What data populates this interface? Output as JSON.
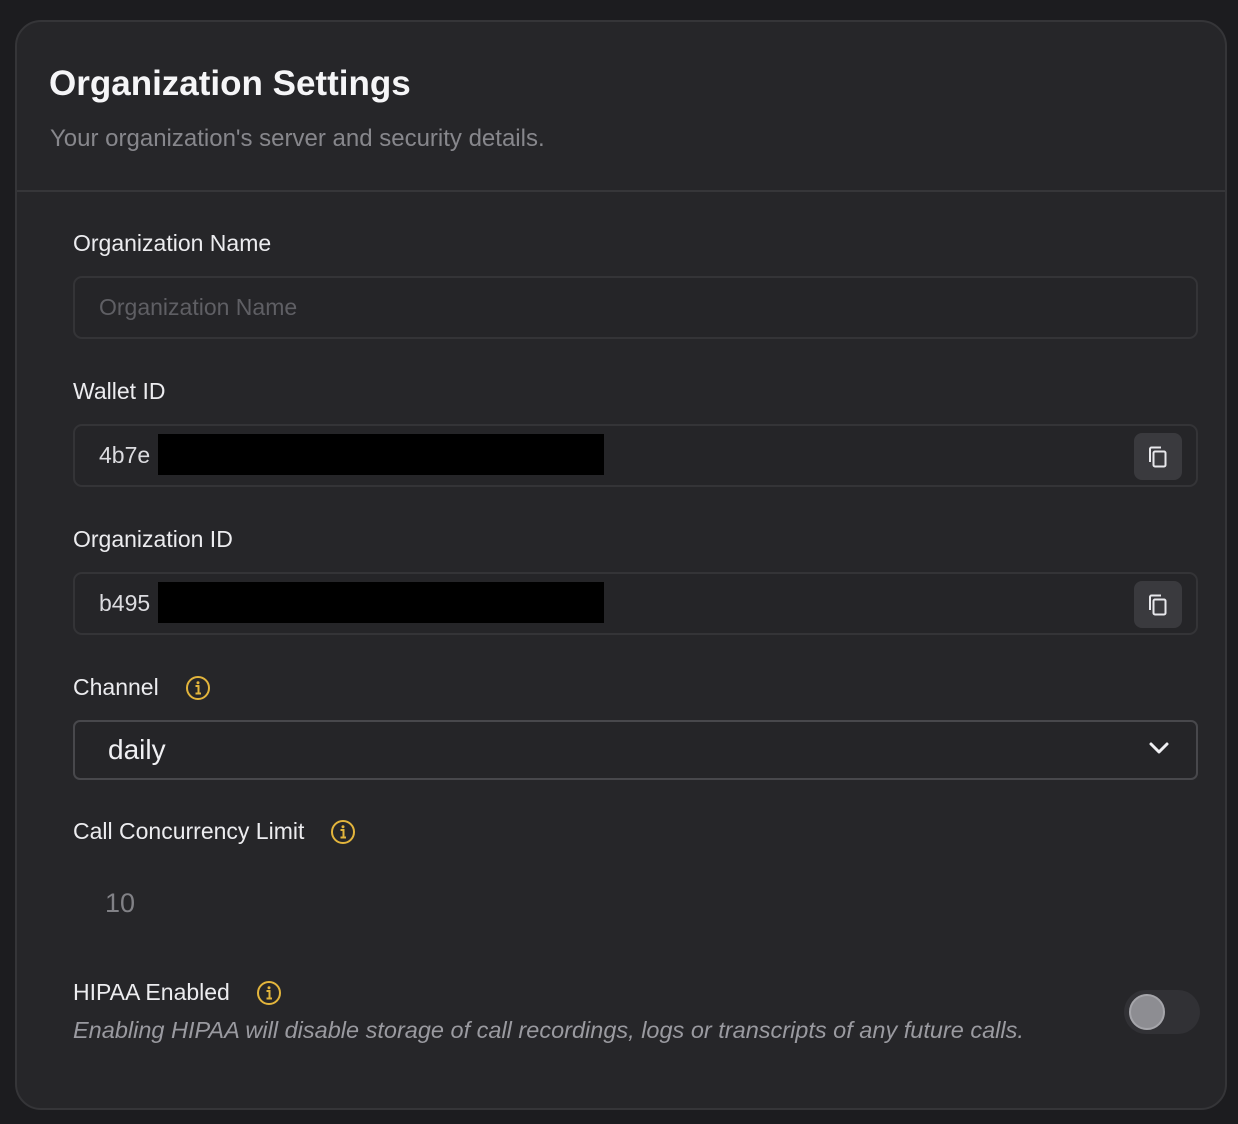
{
  "header": {
    "title": "Organization Settings",
    "subtitle": "Your organization's server and security details."
  },
  "fields": {
    "organization_name": {
      "label": "Organization Name",
      "value": "",
      "placeholder": "Organization Name"
    },
    "wallet_id": {
      "label": "Wallet ID",
      "value_visible": "4b7e",
      "redacted": true,
      "copy_icon": "copy-icon"
    },
    "organization_id": {
      "label": "Organization ID",
      "value_visible": "b495",
      "redacted": true,
      "copy_icon": "copy-icon"
    },
    "channel": {
      "label": "Channel",
      "value": "daily",
      "info_icon": "info-icon"
    },
    "call_concurrency_limit": {
      "label": "Call Concurrency Limit",
      "value": "10",
      "info_icon": "info-icon"
    },
    "hipaa": {
      "label": "HIPAA Enabled",
      "description": "Enabling HIPAA will disable storage of call recordings, logs or transcripts of any future calls.",
      "enabled": false,
      "info_icon": "info-icon"
    }
  },
  "colors": {
    "background": "#1c1c1f",
    "card": "#262629",
    "info_accent": "#e3b53c",
    "text_primary": "#ececef",
    "text_muted": "#87878c"
  }
}
